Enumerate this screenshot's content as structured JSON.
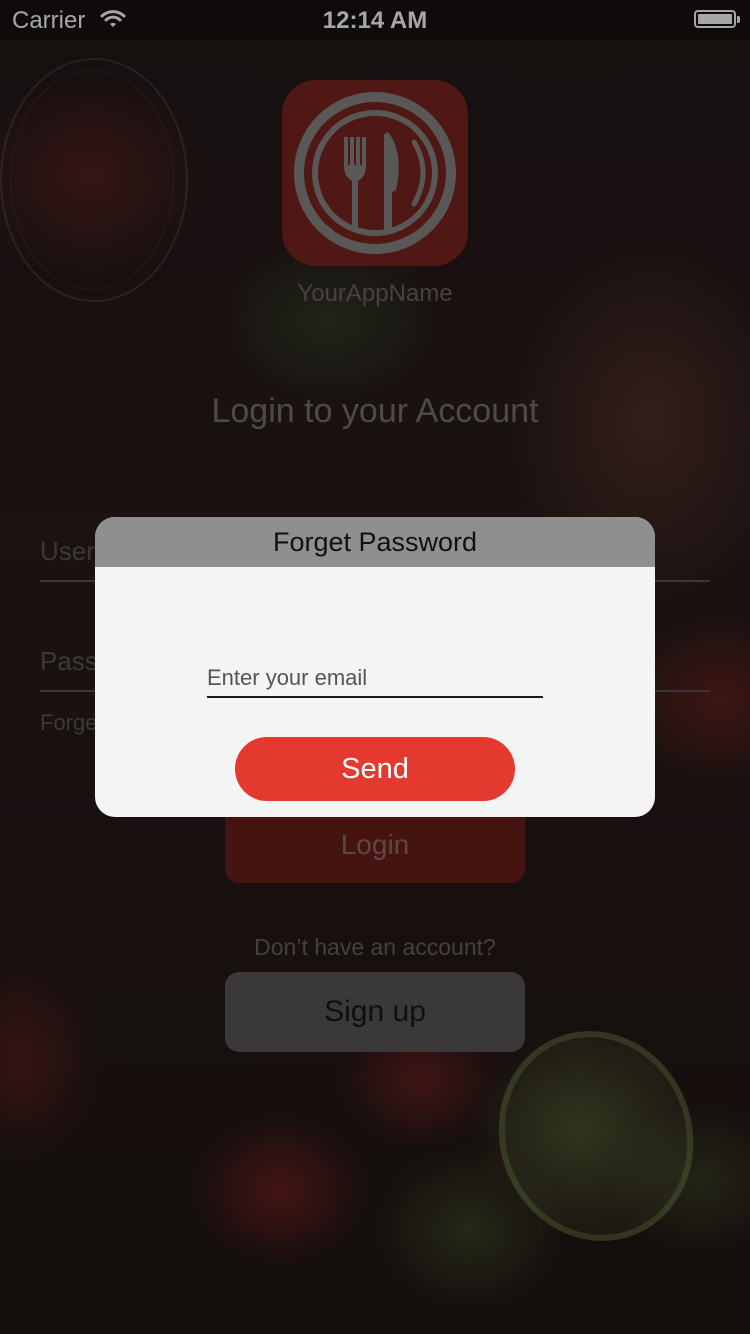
{
  "status_bar": {
    "carrier": "Carrier",
    "time": "12:14 AM"
  },
  "app": {
    "name": "YourAppName",
    "logo_color": "#7a2620"
  },
  "login": {
    "title": "Login to your Account",
    "username_label": "User",
    "password_label": "Pass",
    "forgot_label": "Forge",
    "login_button": "Login",
    "no_account_text": "Don’t have an account?",
    "signup_button": "Sign up"
  },
  "dialog": {
    "title": "Forget Password",
    "email_placeholder": "Enter your email",
    "email_value": "",
    "send_button": "Send",
    "accent_color": "#e3392e"
  }
}
